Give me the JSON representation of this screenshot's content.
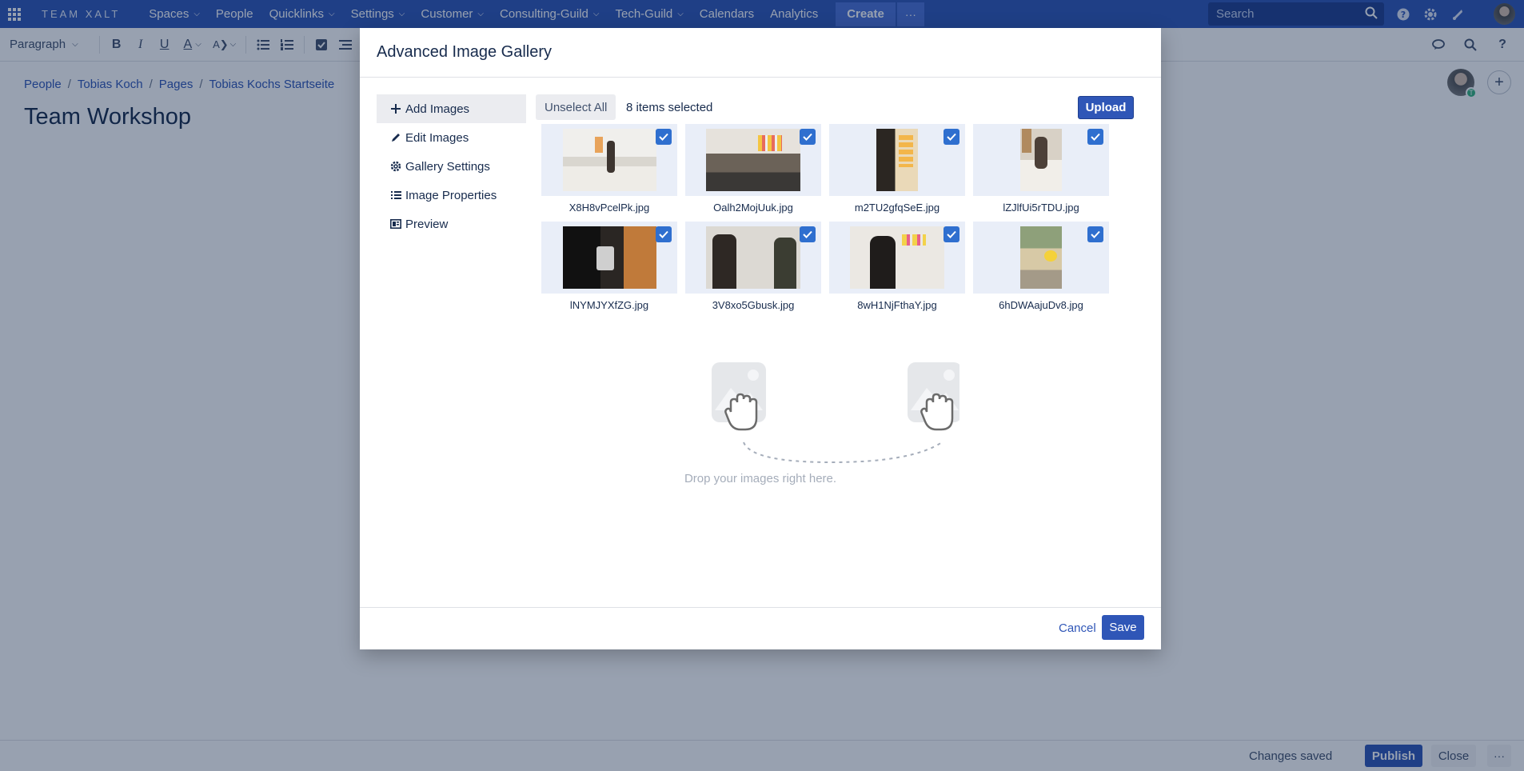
{
  "topnav": {
    "logo": "TEAM XALT",
    "items": [
      {
        "label": "Spaces",
        "has_menu": true
      },
      {
        "label": "People",
        "has_menu": false
      },
      {
        "label": "Quicklinks",
        "has_menu": true
      },
      {
        "label": "Settings",
        "has_menu": true
      },
      {
        "label": "Customer",
        "has_menu": true
      },
      {
        "label": "Consulting-Guild",
        "has_menu": true
      },
      {
        "label": "Tech-Guild",
        "has_menu": true
      },
      {
        "label": "Calendars",
        "has_menu": false
      },
      {
        "label": "Analytics",
        "has_menu": false
      }
    ],
    "create_label": "Create",
    "more_label": "···",
    "search_placeholder": "Search"
  },
  "toolbar": {
    "paragraph_style": "Paragraph"
  },
  "page": {
    "breadcrumb": [
      "People",
      "Tobias Koch",
      "Pages",
      "Tobias Kochs Startseite"
    ],
    "title": "Team Workshop",
    "avatar_badge": "T"
  },
  "bottom": {
    "status": "Changes saved",
    "publish_label": "Publish",
    "close_label": "Close",
    "more_label": "···"
  },
  "modal": {
    "title": "Advanced Image Gallery",
    "nav": [
      {
        "label": "Add Images",
        "icon": "plus-icon",
        "active": true
      },
      {
        "label": "Edit Images",
        "icon": "pencil-icon",
        "active": false
      },
      {
        "label": "Gallery Settings",
        "icon": "gear-icon",
        "active": false
      },
      {
        "label": "Image Properties",
        "icon": "list-icon",
        "active": false
      },
      {
        "label": "Preview",
        "icon": "preview-icon",
        "active": false
      }
    ],
    "unselect_label": "Unselect All",
    "selected_count": "8 items selected",
    "upload_label": "Upload",
    "images": [
      {
        "name": "X8H8vPcelPk.jpg",
        "checked": true
      },
      {
        "name": "Oalh2MojUuk.jpg",
        "checked": true
      },
      {
        "name": "m2TU2gfqSeE.jpg",
        "checked": true
      },
      {
        "name": "lZJlfUi5rTDU.jpg",
        "checked": true
      },
      {
        "name": "lNYMJYXfZG.jpg",
        "checked": true
      },
      {
        "name": "3V8xo5Gbusk.jpg",
        "checked": true
      },
      {
        "name": "8wH1NjFthaY.jpg",
        "checked": true
      },
      {
        "name": "6hDWAajuDv8.jpg",
        "checked": true
      }
    ],
    "drop_text": "Drop your images right here.",
    "cancel_label": "Cancel",
    "save_label": "Save"
  }
}
